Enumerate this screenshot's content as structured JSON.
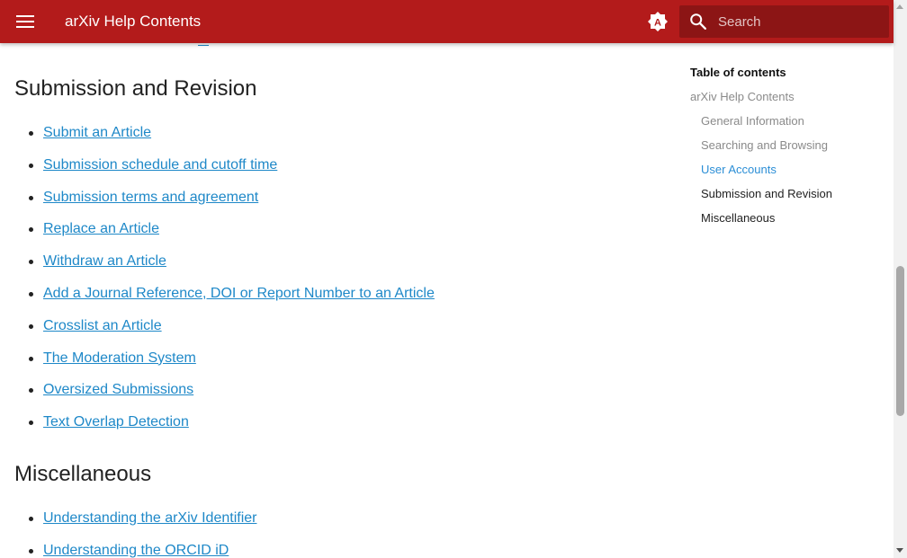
{
  "header": {
    "title": "arXiv Help Contents",
    "search_placeholder": "Search",
    "brand_color": "#b31b1b",
    "theme_icon_letter": "A"
  },
  "sections": [
    {
      "title": "Submission and Revision",
      "links": [
        "Submit an Article",
        "Submission schedule and cutoff time",
        "Submission terms and agreement",
        "Replace an Article",
        "Withdraw an Article",
        "Add a Journal Reference, DOI or Report Number to an Article",
        "Crosslist an Article",
        "The Moderation System",
        "Oversized Submissions",
        "Text Overlap Detection"
      ]
    },
    {
      "title": "Miscellaneous",
      "links": [
        "Understanding the arXiv Identifier",
        "Understanding the ORCID iD"
      ]
    }
  ],
  "toc": {
    "title": "Table of contents",
    "root": "arXiv Help Contents",
    "items": [
      "General Information",
      "Searching and Browsing",
      "User Accounts",
      "Submission and Revision",
      "Miscellaneous"
    ],
    "active_item": "User Accounts"
  },
  "colors": {
    "link": "#1e88c8",
    "toc_active": "#2b8ed6"
  }
}
